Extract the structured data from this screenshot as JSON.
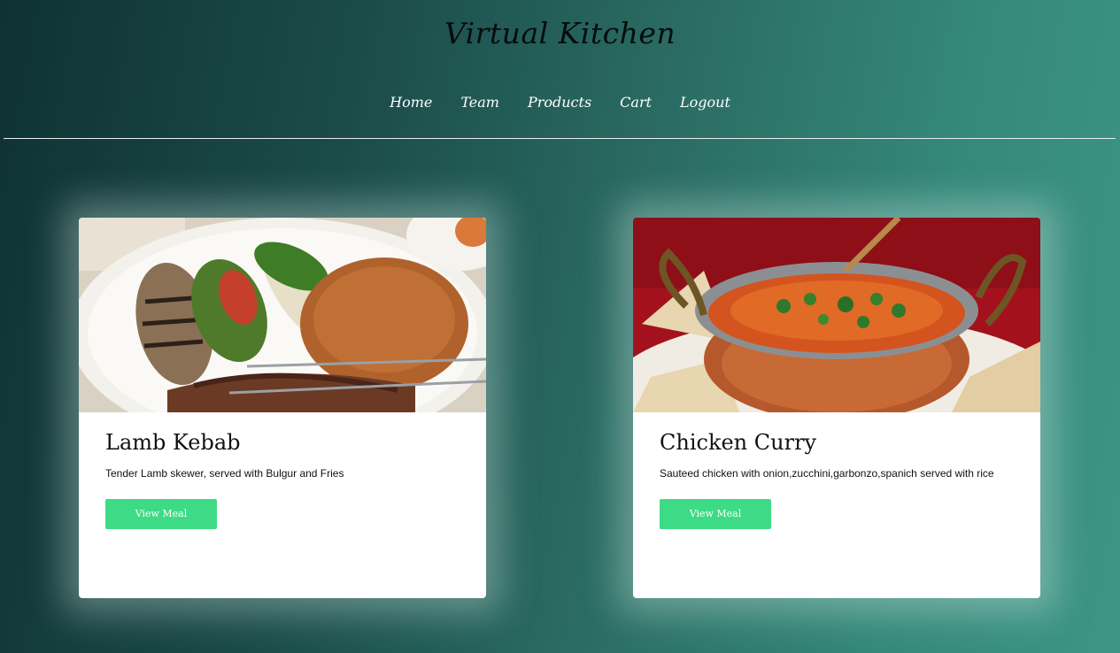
{
  "header": {
    "title": "Virtual Kitchen"
  },
  "nav": {
    "items": [
      {
        "label": "Home"
      },
      {
        "label": "Team"
      },
      {
        "label": "Products"
      },
      {
        "label": "Cart"
      },
      {
        "label": "Logout"
      }
    ]
  },
  "products": [
    {
      "title": "Lamb Kebab",
      "description": "Tender Lamb skewer, served with Bulgur and Fries",
      "button_label": "View Meal",
      "image_alt": "lamb-kebab-photo"
    },
    {
      "title": "Chicken Curry",
      "description": "Sauteed chicken with onion,zucchini,garbonzo,spanich served with rice",
      "button_label": "View Meal",
      "image_alt": "chicken-curry-photo"
    }
  ],
  "colors": {
    "button": "#3ddb85",
    "background_dark": "#0f3233",
    "background_light": "#3d9585"
  }
}
